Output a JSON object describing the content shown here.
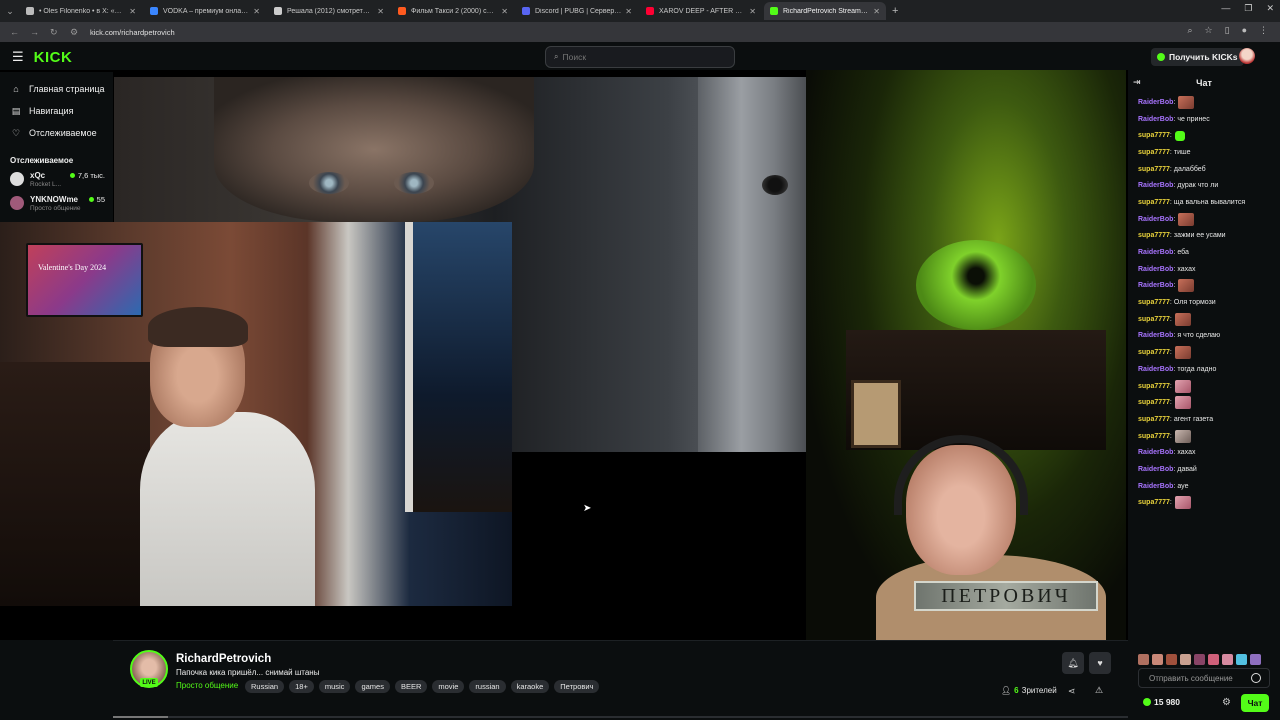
{
  "browser": {
    "tabs": [
      {
        "label": "• Oles Filonenko • в X: «На ка...",
        "color": "#bbbbbb",
        "active": false
      },
      {
        "label": "VODKA – премиум онлайн-ка...",
        "color": "#3a86ff",
        "active": false
      },
      {
        "label": "Решала (2012) смотреть онл...",
        "color": "#cccccc",
        "active": false
      },
      {
        "label": "Фильм Такси 2 (2000) смотреть...",
        "color": "#ff5a1f",
        "active": false
      },
      {
        "label": "Discord | PUBG | Сервер «[Дер...",
        "color": "#5865f2",
        "active": false
      },
      {
        "label": "XAROV DEEP - AFTER 3AM (Or...",
        "color": "#ff0033",
        "active": false
      },
      {
        "label": "RichardPetrovich Stream - K...",
        "color": "#53fc18",
        "active": true
      }
    ],
    "url": "kick.com/richardpetrovich"
  },
  "header": {
    "logo": "KICK",
    "search_placeholder": "Поиск",
    "get_kicks": "Получить KICKs"
  },
  "sidebar": {
    "nav": [
      {
        "label": "Главная страница",
        "icon": "home-icon",
        "glyph": "⌂"
      },
      {
        "label": "Навигация",
        "icon": "compass-icon",
        "glyph": "▤"
      },
      {
        "label": "Отслеживаемое",
        "icon": "heart-icon",
        "glyph": "♡"
      }
    ],
    "following_title": "Отслеживаемое",
    "following": [
      {
        "name": "xQc",
        "sub": "Rocket L...",
        "count": "7,6 тыс.",
        "color": "#dddddd"
      },
      {
        "name": "YNKNOWme",
        "sub": "Просто общение",
        "count": "55",
        "color": "#a05a7a"
      }
    ]
  },
  "video": {
    "tv_text": "Valentine's Day 2024",
    "nameplate": "ПЕТРОВИЧ"
  },
  "chat": {
    "title": "Чат",
    "messages": [
      {
        "user": "RaiderBob",
        "text": "",
        "emote": "brown",
        "color": "p"
      },
      {
        "user": "RaiderBob",
        "text": "че принес",
        "emote": "",
        "color": "p"
      },
      {
        "user": "supa7777",
        "text": "",
        "emote": "green",
        "color": "y"
      },
      {
        "user": "supa7777",
        "text": "тише",
        "emote": "",
        "color": "y"
      },
      {
        "user": "supa7777",
        "text": "далаббеб",
        "emote": "",
        "color": "y"
      },
      {
        "user": "RaiderBob",
        "text": "дурак что ли",
        "emote": "",
        "color": "p"
      },
      {
        "user": "supa7777",
        "text": "ща вальна вывалится",
        "emote": "",
        "color": "y"
      },
      {
        "user": "RaiderBob",
        "text": "",
        "emote": "brown",
        "color": "p"
      },
      {
        "user": "supa7777",
        "text": "зажми ее усами",
        "emote": "",
        "color": "y"
      },
      {
        "user": "RaiderBob",
        "text": "еба",
        "emote": "",
        "color": "p"
      },
      {
        "user": "RaiderBob",
        "text": "хахах",
        "emote": "",
        "color": "p"
      },
      {
        "user": "RaiderBob",
        "text": "",
        "emote": "brown",
        "color": "p"
      },
      {
        "user": "supa7777",
        "text": "Оля тормози",
        "emote": "",
        "color": "y"
      },
      {
        "user": "supa7777",
        "text": "",
        "emote": "brown",
        "color": "y"
      },
      {
        "user": "RaiderBob",
        "text": "я что сделаю",
        "emote": "",
        "color": "p"
      },
      {
        "user": "supa7777",
        "text": "",
        "emote": "brown",
        "color": "y"
      },
      {
        "user": "RaiderBob",
        "text": "тогда ладно",
        "emote": "",
        "color": "p"
      },
      {
        "user": "supa7777",
        "text": "",
        "emote": "pink",
        "color": "y"
      },
      {
        "user": "supa7777",
        "text": "",
        "emote": "pink",
        "color": "y"
      },
      {
        "user": "supa7777",
        "text": "агент газета",
        "emote": "",
        "color": "y"
      },
      {
        "user": "supa7777",
        "text": "",
        "emote": "grey",
        "color": "y"
      },
      {
        "user": "RaiderBob",
        "text": "хахах",
        "emote": "",
        "color": "p"
      },
      {
        "user": "RaiderBob",
        "text": "давай",
        "emote": "",
        "color": "p"
      },
      {
        "user": "RaiderBob",
        "text": "ауе",
        "emote": "",
        "color": "p"
      },
      {
        "user": "supa7777",
        "text": "",
        "emote": "pink",
        "color": "y"
      }
    ],
    "send_placeholder": "Отправить сообщение",
    "kicks_balance": "15 980",
    "chat_button": "Чат"
  },
  "channel": {
    "name": "RichardPetrovich",
    "live_badge": "LIVE",
    "stream_title": "Папочка кика пришёл... снимай штаны",
    "category": "Просто общение",
    "tags": [
      "Russian",
      "18+",
      "music",
      "games",
      "BEER",
      "movie",
      "russian",
      "karaoke",
      "Петрович"
    ],
    "viewers_count": "6",
    "viewers_label": "Зрителей"
  }
}
